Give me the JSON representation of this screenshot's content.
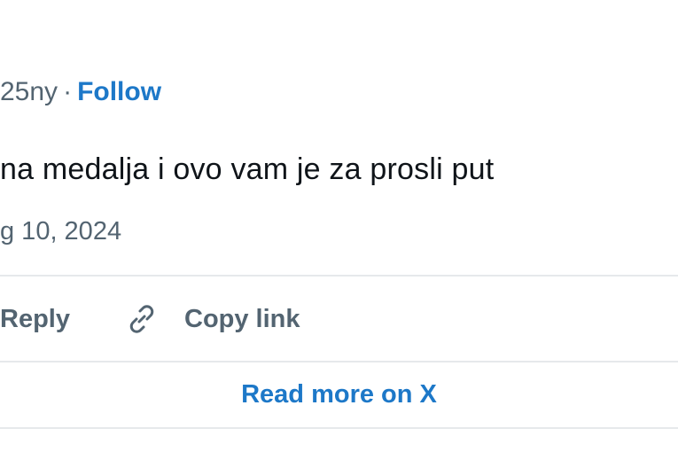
{
  "tweet": {
    "handle_fragment": "25ny",
    "separator": "·",
    "follow_label": "Follow",
    "text": "na medalja i ovo vam je za prosli put",
    "date": "g 10, 2024"
  },
  "actions": {
    "reply_label": "Reply",
    "copy_link_label": "Copy link",
    "copy_link_icon": "link-icon"
  },
  "footer": {
    "read_more_label": "Read more on X"
  },
  "colors": {
    "link_blue": "#1d78c8",
    "muted_gray": "#536471",
    "text_dark": "#0f1419",
    "divider": "#e6e9eb"
  }
}
